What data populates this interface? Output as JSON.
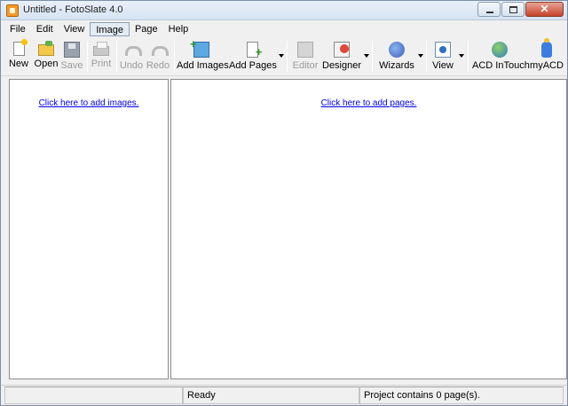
{
  "window": {
    "title": "Untitled - FotoSlate 4.0",
    "buttons": {
      "minimize": "minimize",
      "maximize": "maximize",
      "close": "✕"
    }
  },
  "menu": [
    "File",
    "Edit",
    "View",
    "Image",
    "Page",
    "Help"
  ],
  "menu_active": "Image",
  "toolbar": {
    "new": "New",
    "open": "Open",
    "save": "Save",
    "print": "Print",
    "undo": "Undo",
    "redo": "Redo",
    "add_images": "Add Images",
    "add_pages": "Add Pages",
    "editor": "Editor",
    "designer": "Designer",
    "wizards": "Wizards",
    "view": "View",
    "acd_intouch": "ACD InTouch",
    "my_acd": "myACD"
  },
  "left_pane": {
    "link": "Click here to add images."
  },
  "right_pane": {
    "link": "Click here to add pages."
  },
  "status": {
    "cell1": "",
    "cell2": "Ready",
    "cell3": "Project contains 0 page(s)."
  },
  "colors": {
    "link": "#0000ee",
    "titlebar": "#d5e3f2",
    "close_button": "#c7432a"
  },
  "icons": [
    "app-icon",
    "new-icon",
    "open-icon",
    "save-icon",
    "print-icon",
    "undo-icon",
    "redo-icon",
    "add-images-icon",
    "add-pages-icon",
    "editor-icon",
    "designer-icon",
    "wizards-icon",
    "view-icon",
    "acd-intouch-icon",
    "myacd-icon"
  ]
}
